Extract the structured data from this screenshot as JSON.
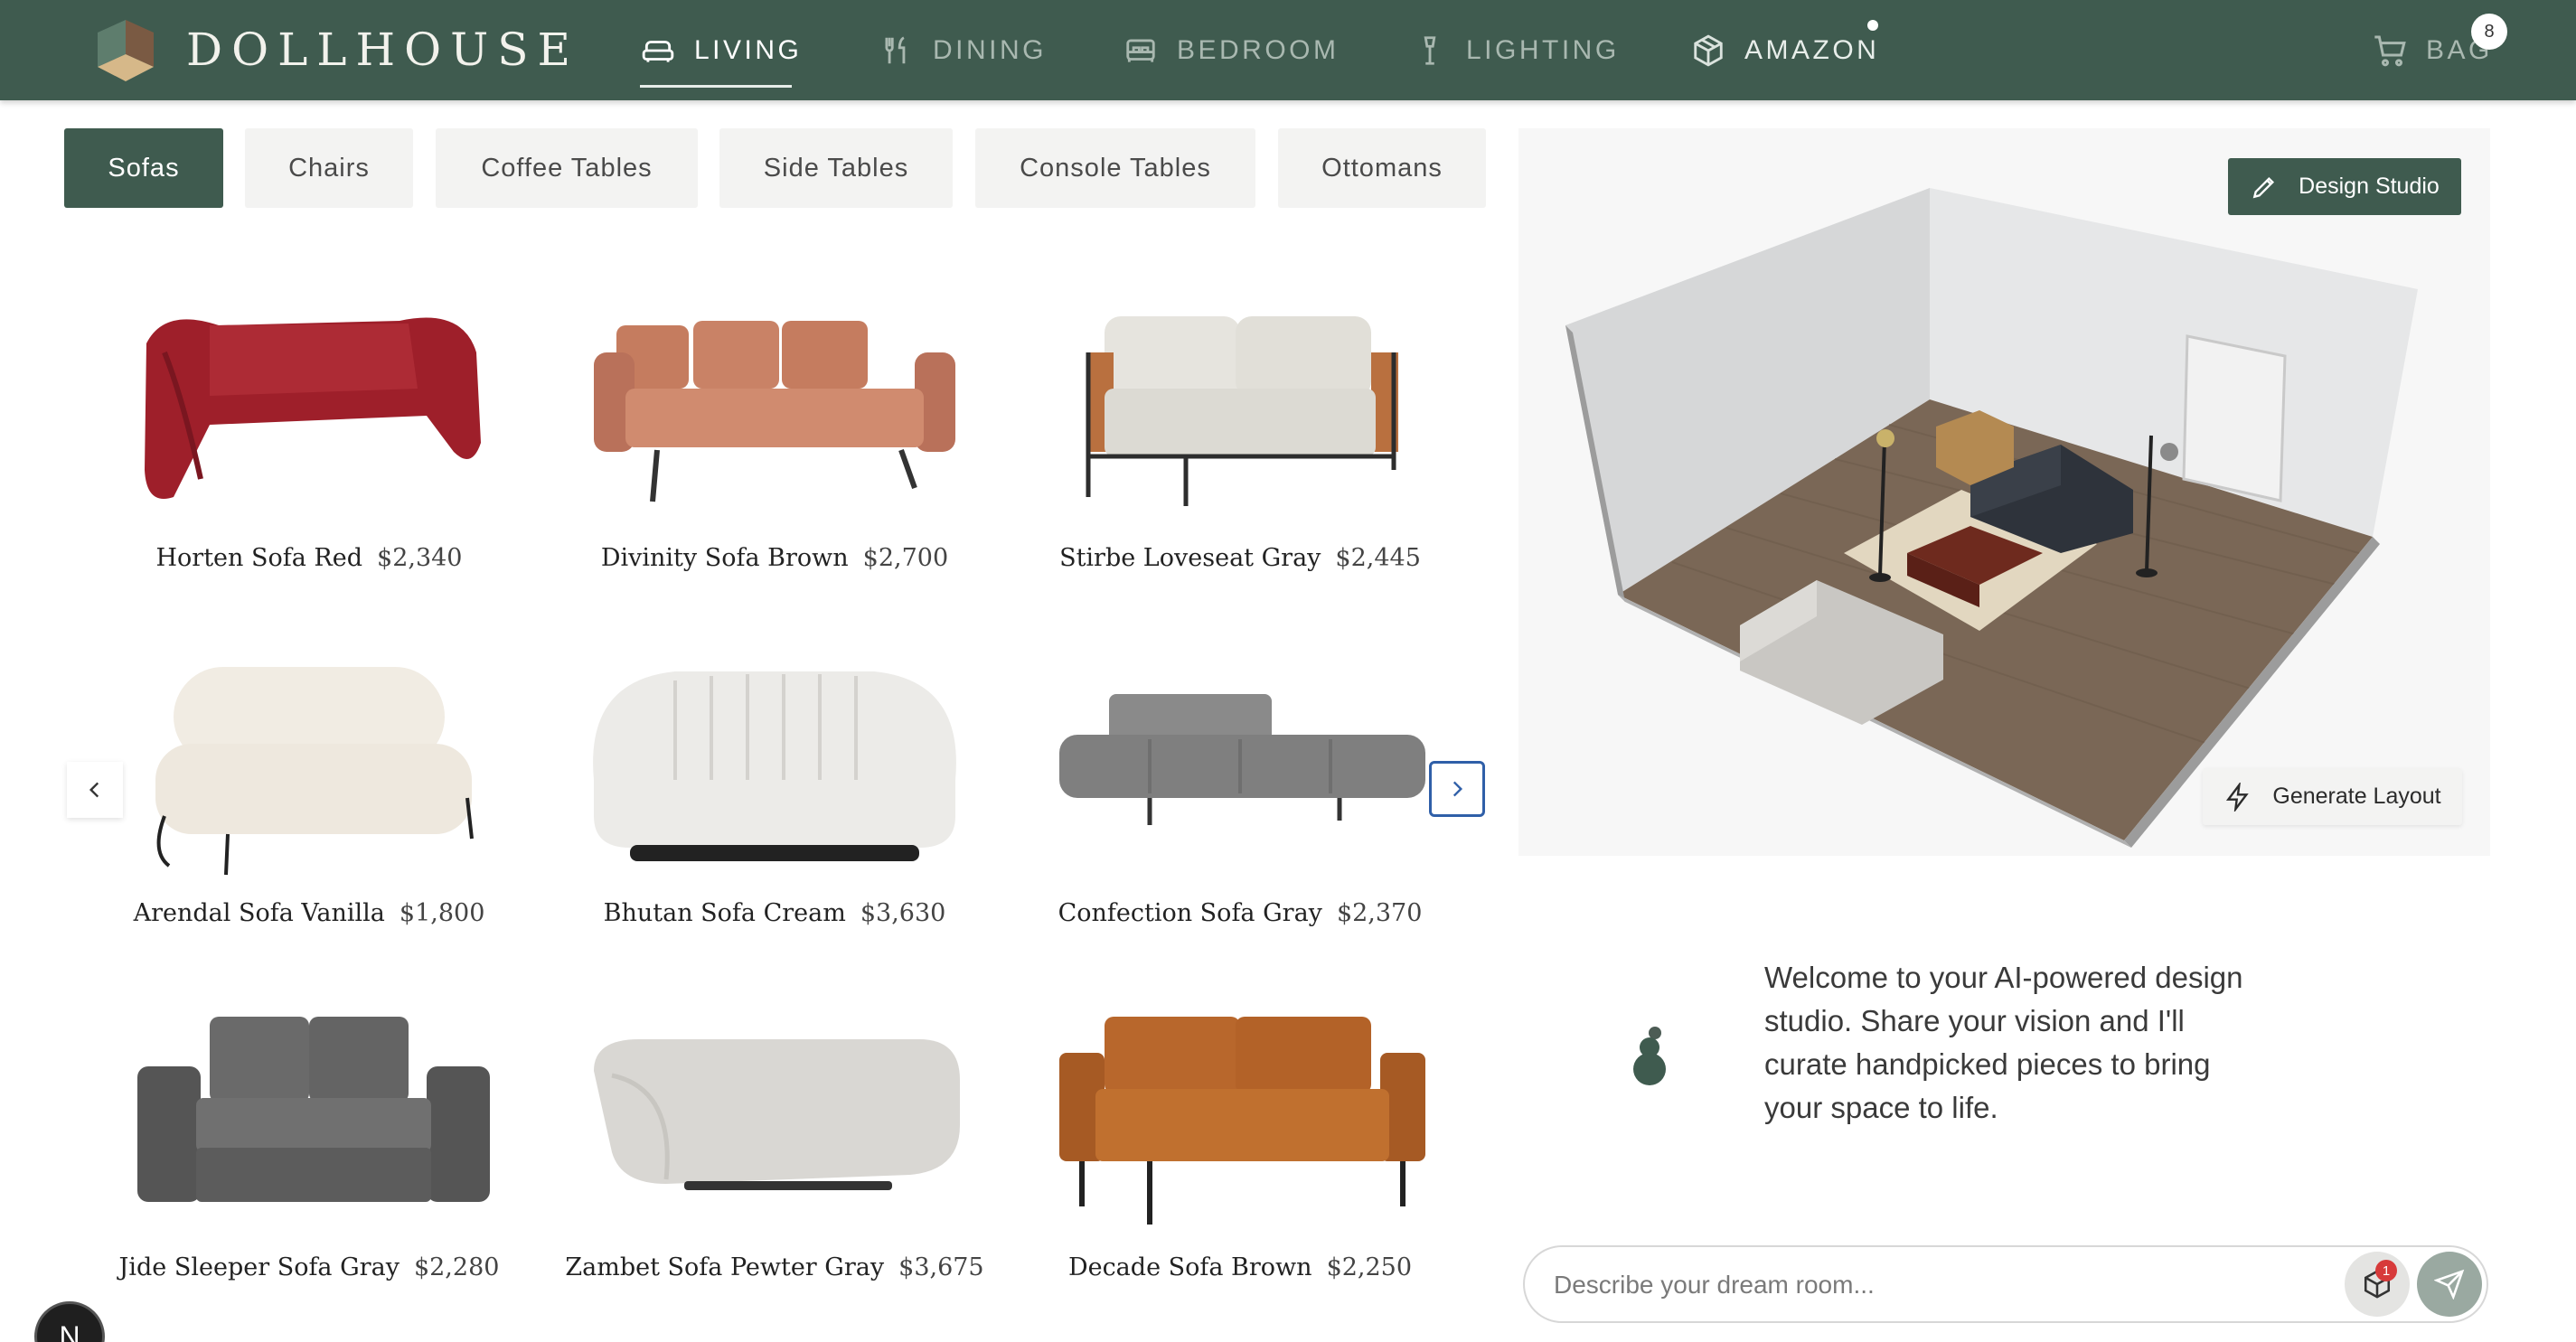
{
  "brand": {
    "name": "DOLLHOUSE"
  },
  "nav": {
    "items": [
      {
        "label": "LIVING",
        "icon": "sofa-icon",
        "active": true
      },
      {
        "label": "DINING",
        "icon": "fork-knife-icon",
        "active": false
      },
      {
        "label": "BEDROOM",
        "icon": "bed-icon",
        "active": false
      },
      {
        "label": "LIGHTING",
        "icon": "lamp-icon",
        "active": false
      },
      {
        "label": "AMAZON",
        "icon": "box-icon",
        "active": false
      }
    ],
    "bag": {
      "label": "BAG",
      "count": "8",
      "icon": "cart-icon"
    }
  },
  "categories": {
    "tabs": [
      {
        "label": "Sofas",
        "active": true
      },
      {
        "label": "Chairs",
        "active": false
      },
      {
        "label": "Coffee Tables",
        "active": false
      },
      {
        "label": "Side Tables",
        "active": false
      },
      {
        "label": "Console Tables",
        "active": false
      },
      {
        "label": "Ottomans",
        "active": false
      }
    ]
  },
  "products": [
    {
      "name": "Horten Sofa Red",
      "price": "$2,340",
      "color": "#9e1f2a"
    },
    {
      "name": "Divinity Sofa Brown",
      "price": "$2,700",
      "color": "#c98266"
    },
    {
      "name": "Stirbe Loveseat Gray",
      "price": "$2,445",
      "color": "#e6e4de"
    },
    {
      "name": "Arendal Sofa Vanilla",
      "price": "$1,800",
      "color": "#f1ece3"
    },
    {
      "name": "Bhutan Sofa Cream",
      "price": "$3,630",
      "color": "#ecebe8"
    },
    {
      "name": "Confection Sofa Gray",
      "price": "$2,370",
      "color": "#8a8a8a"
    },
    {
      "name": "Jide Sleeper Sofa Gray",
      "price": "$2,280",
      "color": "#5c5c5c"
    },
    {
      "name": "Zambet Sofa Pewter Gray",
      "price": "$3,675",
      "color": "#d9d7d3"
    },
    {
      "name": "Decade Sofa Brown",
      "price": "$2,250",
      "color": "#b8672c"
    }
  ],
  "viewer": {
    "design_studio_label": "Design Studio",
    "generate_layout_label": "Generate Layout"
  },
  "chat": {
    "welcome": "Welcome to your AI-powered design studio. Share your vision and I'll curate handpicked pieces to bring your space to life.",
    "placeholder": "Describe your dream room...",
    "cube_badge": "1"
  },
  "user": {
    "initial": "N"
  },
  "colors": {
    "brand": "#3f5b4f",
    "accent_blue": "#2f5fa8",
    "badge_red": "#d73a3a"
  }
}
